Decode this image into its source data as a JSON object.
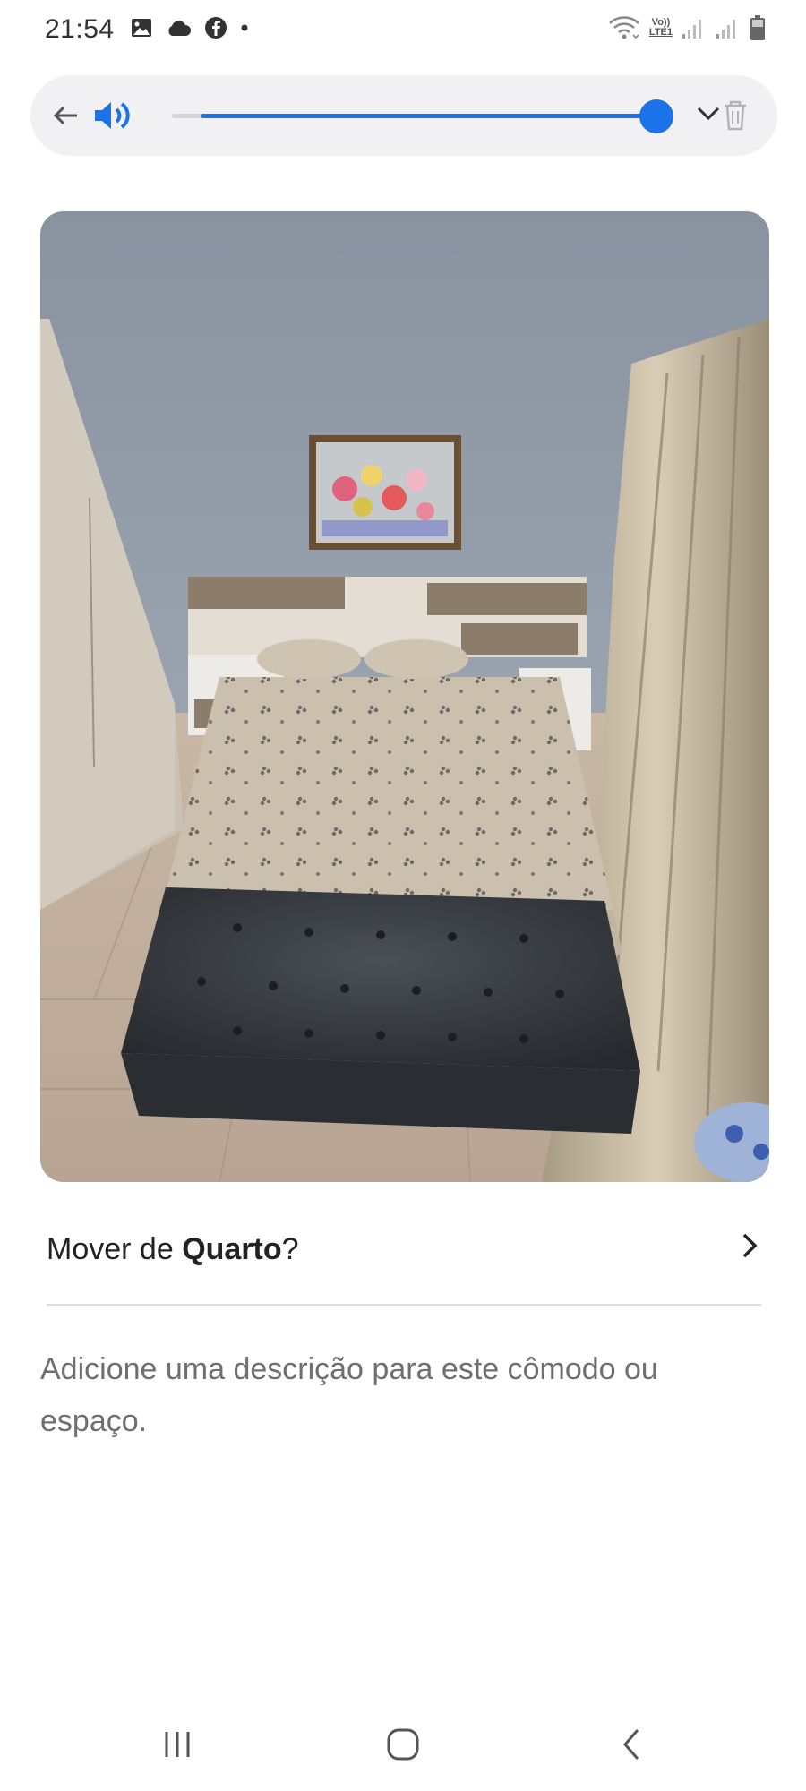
{
  "status_bar": {
    "time": "21:54",
    "left_icons": [
      "gallery-icon",
      "cloud-icon",
      "facebook-icon",
      "dot-icon"
    ],
    "right_icons": [
      "wifi-icon",
      "volte-lte-icon",
      "signal-icon",
      "signal-icon",
      "battery-icon"
    ],
    "network_label_top": "Vo))",
    "network_label_bottom": "LTE1"
  },
  "volume_overlay": {
    "level_percent": 100,
    "accent_color": "#1a73e8",
    "icons": [
      "back-arrow-icon",
      "speaker-icon",
      "chevron-down-icon",
      "trash-icon"
    ]
  },
  "photo": {
    "subject": "room-photo"
  },
  "move_row": {
    "prefix": "Mover de ",
    "room": "Quarto",
    "suffix": "?"
  },
  "description": {
    "placeholder": "Adicione uma descrição para este cômodo ou espaço."
  },
  "nav_bar": {
    "buttons": [
      "recent-apps-icon",
      "home-icon",
      "back-icon"
    ]
  }
}
